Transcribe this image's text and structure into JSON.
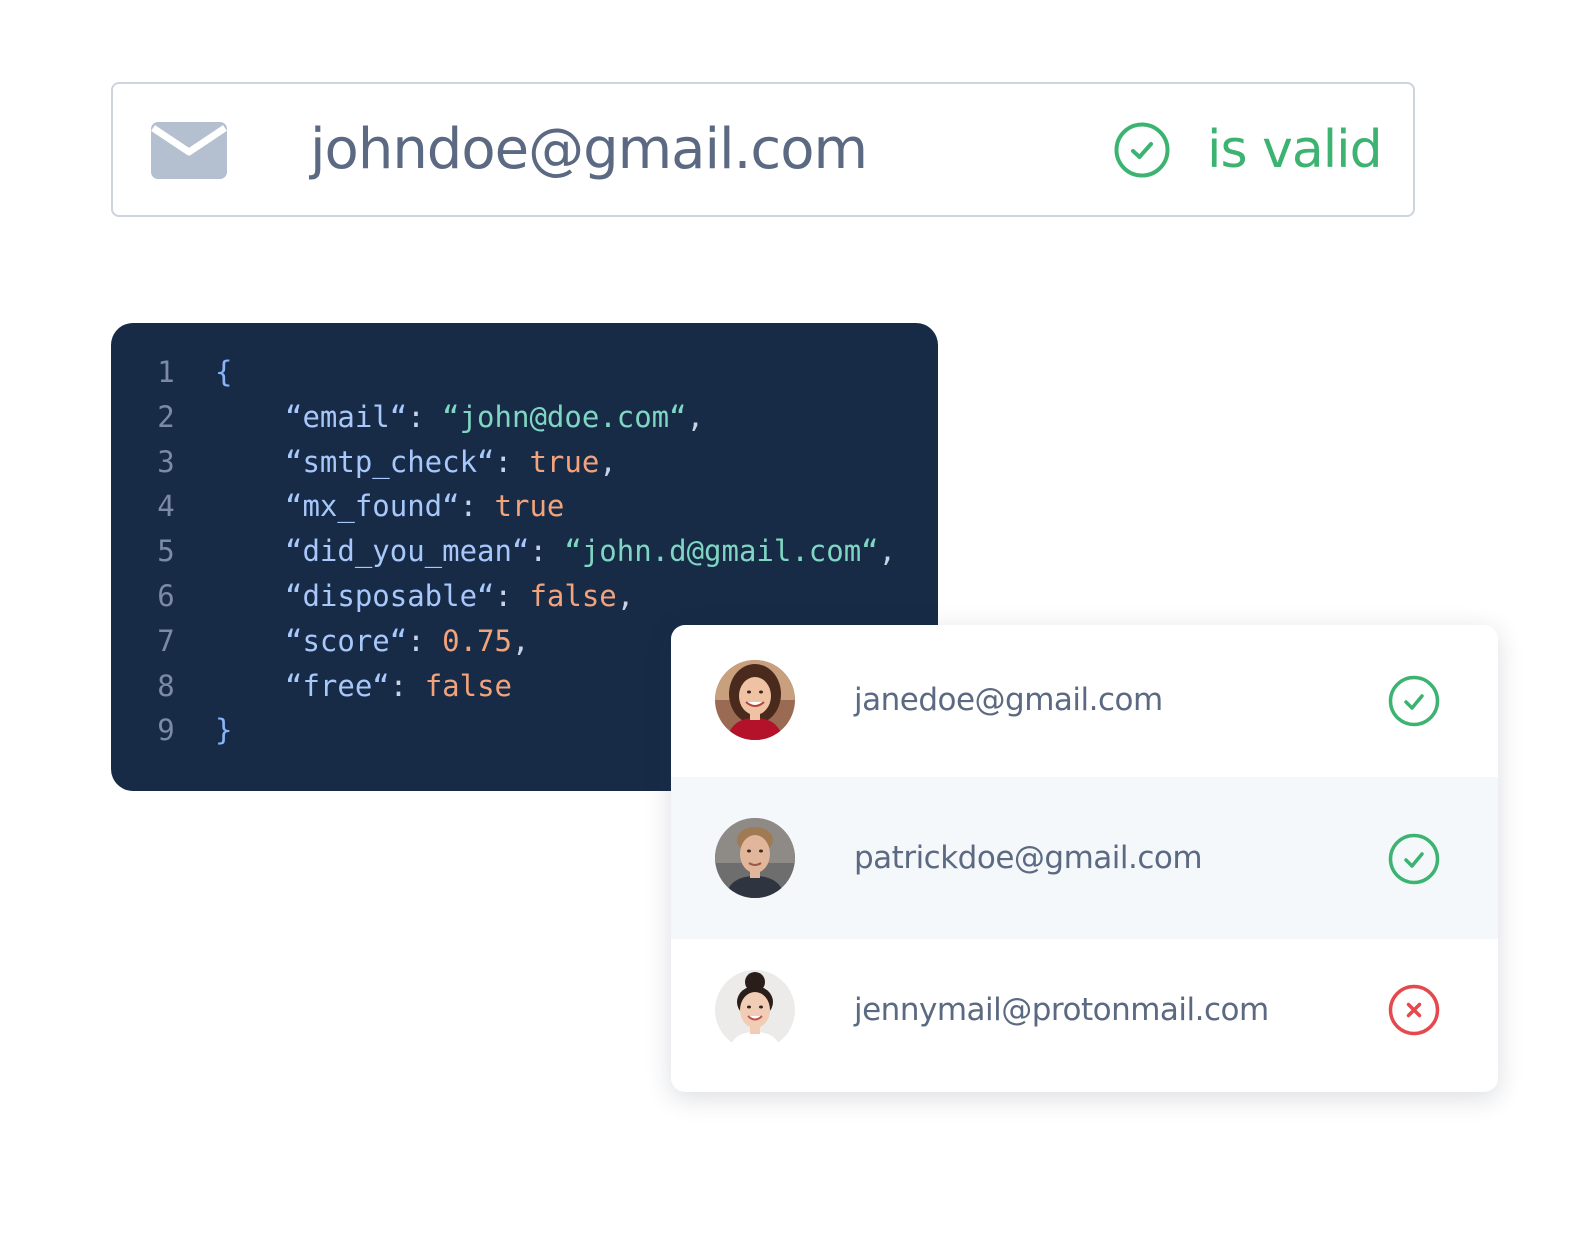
{
  "email_check": {
    "icon": "envelope-icon",
    "value": "johndoe@gmail.com",
    "status_icon": "check-circle-icon",
    "status_text": "is valid",
    "status_color": "#3cb371"
  },
  "code": {
    "lines": [
      {
        "n": "1",
        "brace": "{"
      },
      {
        "n": "2",
        "key": "“email“",
        "sep": ": ",
        "val": "“john@doe.com“",
        "val_type": "str",
        "tail": ","
      },
      {
        "n": "3",
        "key": "“smtp_check“",
        "sep": ": ",
        "val": "true",
        "val_type": "bool",
        "tail": ","
      },
      {
        "n": "4",
        "key": "“mx_found“",
        "sep": ": ",
        "val": "true",
        "val_type": "bool",
        "tail": ""
      },
      {
        "n": "5",
        "key": "“did_you_mean“",
        "sep": ": ",
        "val": "“john.d@gmail.com“",
        "val_type": "str",
        "tail": ","
      },
      {
        "n": "6",
        "key": "“disposable“",
        "sep": ": ",
        "val": "false",
        "val_type": "bool",
        "tail": ","
      },
      {
        "n": "7",
        "key": "“score“",
        "sep": ": ",
        "val": "0.75",
        "val_type": "num",
        "tail": ","
      },
      {
        "n": "8",
        "key": "“free“",
        "sep": ": ",
        "val": "false",
        "val_type": "bool",
        "tail": ""
      },
      {
        "n": "9",
        "brace": "}"
      }
    ]
  },
  "list": {
    "rows": [
      {
        "email": "janedoe@gmail.com",
        "status": "valid",
        "status_icon": "check-circle-icon",
        "avatar": "avatar-woman-red-top"
      },
      {
        "email": "patrickdoe@gmail.com",
        "status": "valid",
        "status_icon": "check-circle-icon",
        "avatar": "avatar-man"
      },
      {
        "email": "jennymail@protonmail.com",
        "status": "invalid",
        "status_icon": "x-circle-icon",
        "avatar": "avatar-woman-bun"
      }
    ],
    "valid_color": "#3cb371",
    "invalid_color": "#e5484d"
  }
}
